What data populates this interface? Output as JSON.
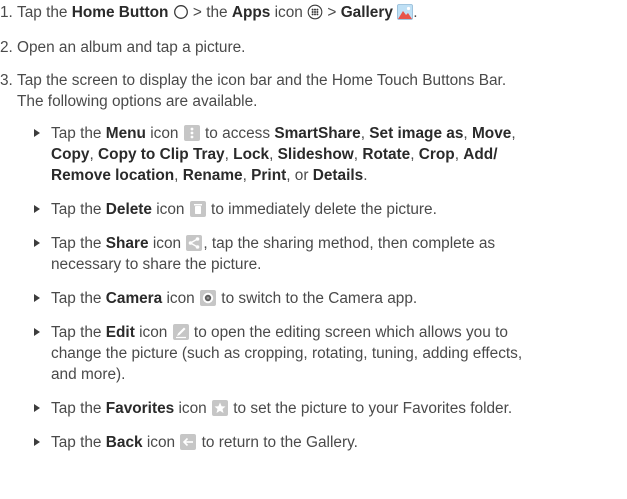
{
  "steps": [
    {
      "number": "1.",
      "p1": "Tap the ",
      "home_button": "Home Button",
      "p2": " > the ",
      "apps": "Apps",
      "p3": " icon ",
      "p4": " > ",
      "gallery": "Gallery",
      "p5": "."
    },
    {
      "number": "2.",
      "text": "Open an album and tap a picture."
    },
    {
      "number": "3.",
      "line1": "Tap the screen to display the icon bar and the Home Touch Buttons Bar.",
      "line2": "The following options are available."
    }
  ],
  "bullets": {
    "menu": {
      "a": "Tap the ",
      "name": "Menu",
      "b": " icon ",
      "c": " to access ",
      "i1": "SmartShare",
      "i2": "Set image as",
      "i3": "Move",
      "i4": "Copy",
      "i5": "Copy to Clip Tray",
      "i6": "Lock",
      "i7": "Slideshow",
      "i8": "Rotate",
      "i9": "Crop",
      "i10": "Add/",
      "i11": "Remove location",
      "i12": "Rename",
      "i13": "Print",
      "i14": "Details",
      "or": ", or ",
      "end": "."
    },
    "delete": {
      "a": "Tap the ",
      "name": "Delete",
      "b": " icon ",
      "c": " to immediately delete the picture."
    },
    "share": {
      "a": "Tap the ",
      "name": "Share",
      "b": " icon ",
      "c": ", tap the sharing method, then complete as",
      "line2": "necessary to share the picture."
    },
    "camera": {
      "a": "Tap the ",
      "name": "Camera",
      "b": " icon ",
      "c": " to switch to the Camera app."
    },
    "edit": {
      "a": "Tap the ",
      "name": "Edit",
      "b": " icon ",
      "c": " to open the editing screen which allows you to",
      "line2": "change the picture (such as cropping, rotating, tuning, adding effects,",
      "line3": "and more)."
    },
    "favorites": {
      "a": "Tap the ",
      "name": "Favorites",
      "b": " icon ",
      "c": " to set the picture to your Favorites folder."
    },
    "back": {
      "a": "Tap the ",
      "name": "Back",
      "b": " icon ",
      "c": " to return to the Gallery."
    }
  },
  "icons": {
    "home": "home-circle-icon",
    "apps": "apps-grid-icon",
    "gallery": "gallery-icon",
    "menu": "menu-icon",
    "delete": "delete-icon",
    "share": "share-icon",
    "camera": "camera-icon",
    "edit": "edit-icon",
    "favorites": "favorites-icon",
    "back": "back-icon",
    "icon_bg": "#c6c6c6",
    "text_color": "#4a4a4a",
    "bold_color": "#2a2a2a"
  }
}
